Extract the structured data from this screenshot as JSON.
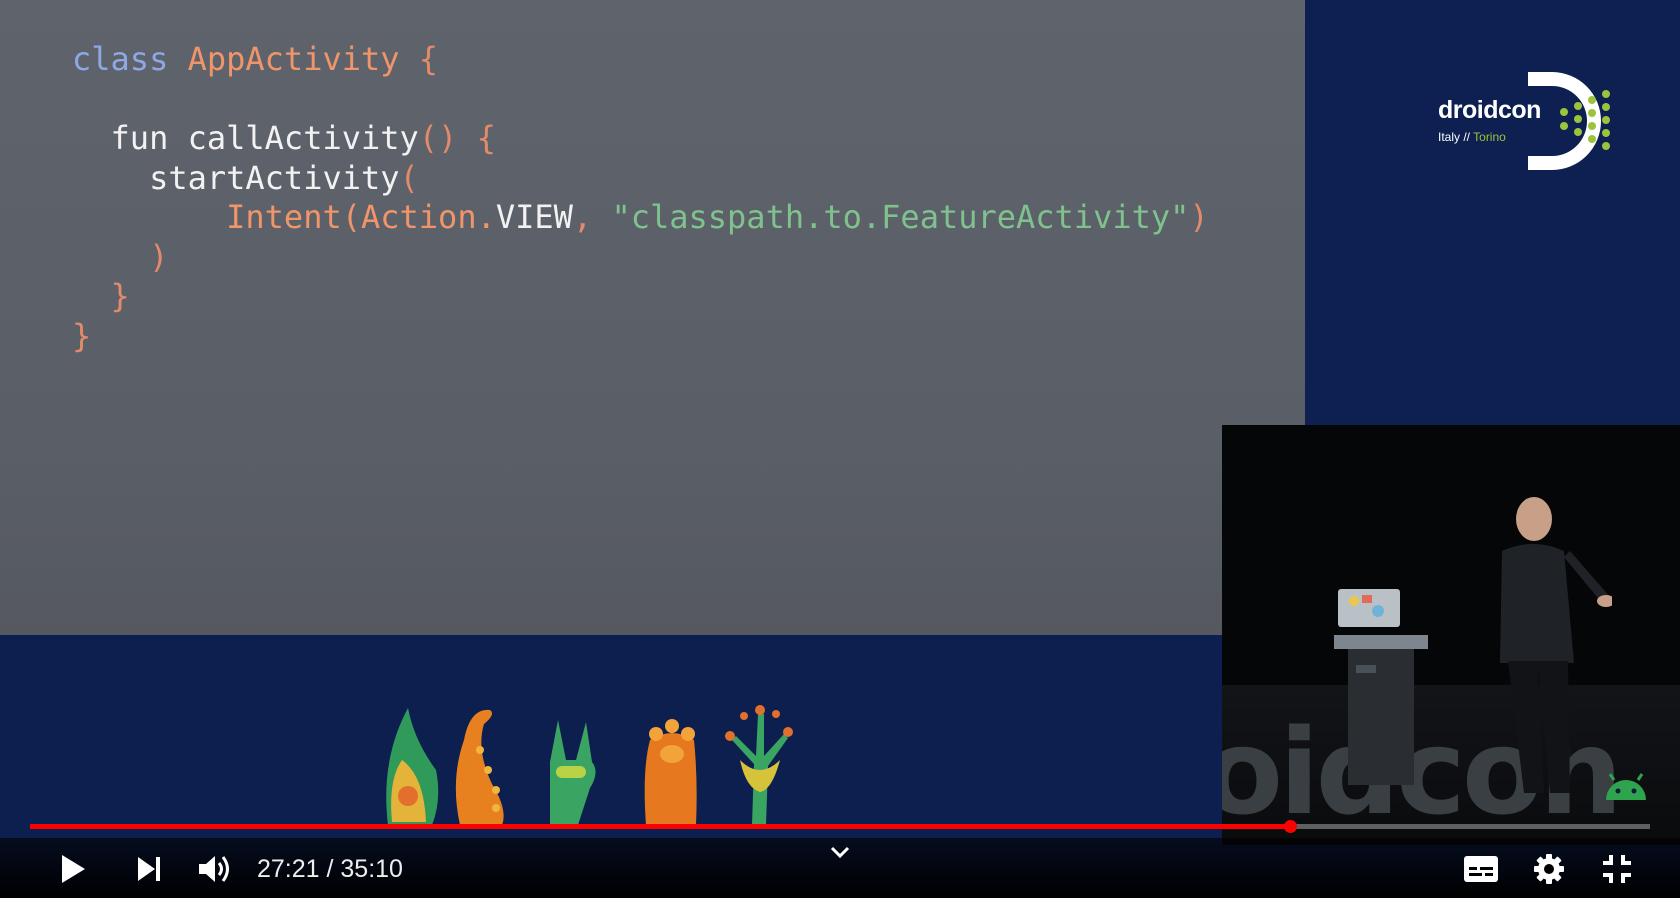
{
  "slide": {
    "code_lines": [
      [
        {
          "t": "class ",
          "c": "kw"
        },
        {
          "t": "AppActivity ",
          "c": "cls"
        },
        {
          "t": "{",
          "c": "pun"
        }
      ],
      [],
      [
        {
          "t": "  fun ",
          "c": "fn"
        },
        {
          "t": "callActivity",
          "c": "fn"
        },
        {
          "t": "() {",
          "c": "pun"
        }
      ],
      [
        {
          "t": "    startActivity",
          "c": "fn"
        },
        {
          "t": "(",
          "c": "pun"
        }
      ],
      [
        {
          "t": "        Intent(Action.",
          "c": "cls"
        },
        {
          "t": "VIEW",
          "c": "cst"
        },
        {
          "t": ", ",
          "c": "pun"
        },
        {
          "t": "\"classpath.to.FeatureActivity\"",
          "c": "str"
        },
        {
          "t": ")",
          "c": "pun"
        }
      ],
      [
        {
          "t": "    )",
          "c": "pun"
        }
      ],
      [
        {
          "t": "  }",
          "c": "pun"
        }
      ],
      [
        {
          "t": "}",
          "c": "pun"
        }
      ]
    ]
  },
  "branding": {
    "logo_word": "droidcon",
    "logo_region": "Italy // ",
    "logo_city": "Torino",
    "stage_sign": "oidcon"
  },
  "player": {
    "time_current": "27:21",
    "time_total": "35:10",
    "time_display": "27:21 / 35:10",
    "progress_fraction": 0.7779,
    "buttons": {
      "play": "play-icon",
      "next": "next-icon",
      "volume": "volume-icon",
      "chapters": "chevron-down-icon",
      "subtitles": "subtitles-icon",
      "settings": "gear-icon",
      "exit_fullscreen": "exit-fullscreen-icon"
    }
  },
  "colors": {
    "progress": "#ff0000",
    "brand_accent": "#9bc43c",
    "slide_bg": "#5d6169",
    "brand_bg": "#0d2051"
  }
}
